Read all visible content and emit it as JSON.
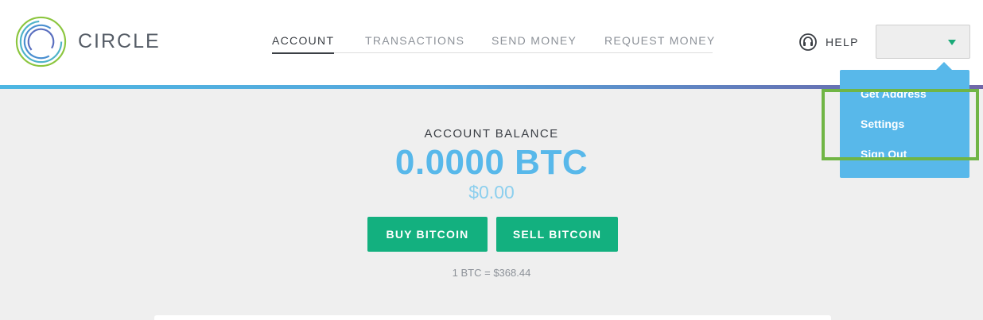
{
  "brand": {
    "name": "CIRCLE",
    "logo_icon": "circle-rings-logo"
  },
  "nav": {
    "items": [
      {
        "label": "ACCOUNT",
        "active": true
      },
      {
        "label": "TRANSACTIONS",
        "active": false
      },
      {
        "label": "SEND MONEY",
        "active": false
      },
      {
        "label": "REQUEST MONEY",
        "active": false
      }
    ]
  },
  "help": {
    "label": "HELP",
    "icon": "headset-icon"
  },
  "account_menu": {
    "value": "",
    "items": [
      "Get Address",
      "Settings",
      "Sign Out"
    ]
  },
  "balance": {
    "label": "ACCOUNT BALANCE",
    "btc": "0.0000 BTC",
    "usd": "$0.00"
  },
  "actions": {
    "buy": "BUY BITCOIN",
    "sell": "SELL BITCOIN"
  },
  "rate": "1 BTC = $368.44",
  "colors": {
    "brand_blue": "#58b8ea",
    "action_green": "#13b07f",
    "highlight_green": "#70b545",
    "background": "#efefef"
  }
}
